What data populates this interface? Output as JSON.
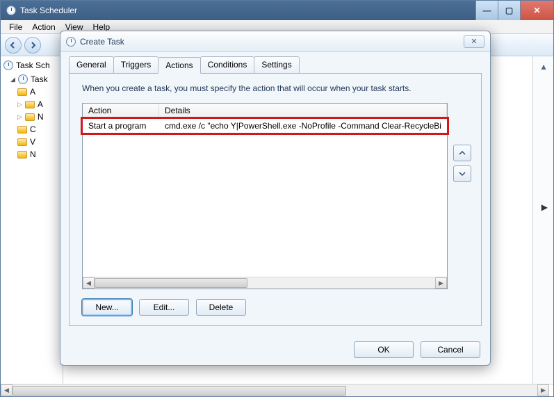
{
  "window": {
    "title": "Task Scheduler",
    "menus": [
      "File",
      "Action",
      "View",
      "Help"
    ]
  },
  "tree": {
    "root": "Task Sch",
    "library": "Task",
    "children": [
      "A",
      "A",
      "N",
      "C",
      "V",
      "N"
    ]
  },
  "dialog": {
    "title": "Create Task",
    "tabs": {
      "general": "General",
      "triggers": "Triggers",
      "actions": "Actions",
      "conditions": "Conditions",
      "settings": "Settings"
    },
    "active_tab": "actions",
    "description": "When you create a task, you must specify the action that will occur when your task starts.",
    "columns": {
      "action": "Action",
      "details": "Details"
    },
    "rows": [
      {
        "action": "Start a program",
        "details": "cmd.exe /c \"echo Y|PowerShell.exe -NoProfile -Command Clear-RecycleBi"
      }
    ],
    "buttons": {
      "new": "New...",
      "edit": "Edit...",
      "delete": "Delete",
      "ok": "OK",
      "cancel": "Cancel"
    }
  }
}
